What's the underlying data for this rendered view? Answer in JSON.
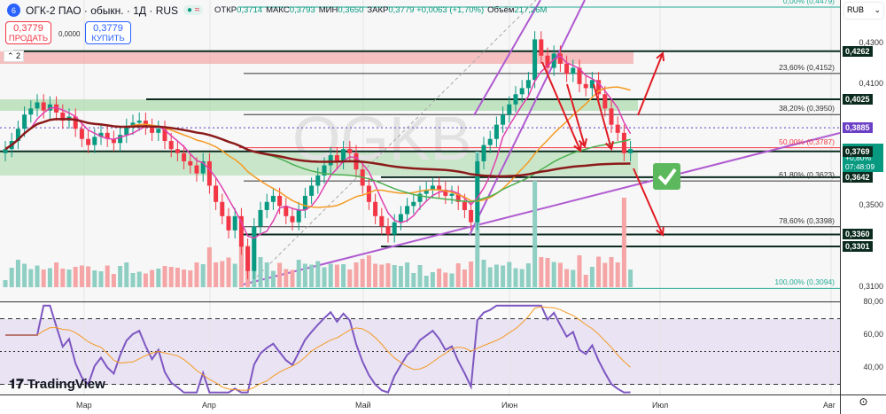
{
  "header": {
    "logo": "6",
    "symbol": "ОГК-2 ПАО · обыкн. · 1Д · RUS",
    "market_status": "●",
    "delay_icon": "≈",
    "ohlc": [
      {
        "k": "ОТКР",
        "v": "0,3714"
      },
      {
        "k": "МАКС",
        "v": "0,3793"
      },
      {
        "k": "МИН",
        "v": "0,3650"
      },
      {
        "k": "ЗАКР",
        "v": "0,3779 +0,0063 (+1,70%)"
      },
      {
        "k": "Объём",
        "v": "217,26M"
      }
    ]
  },
  "trade": {
    "sell_price": "0,3779",
    "sell_label": "ПРОДАТЬ",
    "spread": "0,0000",
    "buy_price": "0,3779",
    "buy_label": "КУПИТЬ"
  },
  "indicator_count": "2",
  "currency": "RUB",
  "price_axis": [
    "0,4300",
    "0,4100",
    "0,3500",
    "0,3100"
  ],
  "price_tags": [
    {
      "v": "0,4262",
      "p": 0.4262
    },
    {
      "v": "0,4025",
      "p": 0.4025
    },
    {
      "v": "0,3769",
      "p": 0.3769
    },
    {
      "v": "0,3642",
      "p": 0.3642
    },
    {
      "v": "0,3360",
      "p": 0.336
    },
    {
      "v": "0,3301",
      "p": 0.3301
    }
  ],
  "ma_tag": {
    "v": "0,3885",
    "p": 0.3885
  },
  "current": {
    "price": "0,3779",
    "change": "+0,80%",
    "countdown": "07:48:09"
  },
  "fib": [
    {
      "label": "0,00% (0,4479)",
      "p": 0.4479,
      "color": "#22ab94"
    },
    {
      "label": "23,60% (0,4152)",
      "p": 0.4152,
      "color": "#333"
    },
    {
      "label": "38,20% (0,3950)",
      "p": 0.395,
      "color": "#333"
    },
    {
      "label": "50,00% (0,3787)",
      "p": 0.3787,
      "color": "#f23645"
    },
    {
      "label": "61,80% (0,3623)",
      "p": 0.3623,
      "color": "#333"
    },
    {
      "label": "78,60% (0,3398)",
      "p": 0.3398,
      "color": "#333"
    },
    {
      "label": "100,00% (0,3094)",
      "p": 0.3094,
      "color": "#22ab94"
    }
  ],
  "rsi_axis": [
    "80,00",
    "60,00",
    "40,00"
  ],
  "time_axis": [
    {
      "l": "Мар",
      "x": 95
    },
    {
      "l": "Апр",
      "x": 237
    },
    {
      "l": "Май",
      "x": 410
    },
    {
      "l": "Июн",
      "x": 575
    },
    {
      "l": "Июл",
      "x": 745
    },
    {
      "l": "Авг",
      "x": 938
    }
  ],
  "brand": "TradingView",
  "watermark": "OGKB",
  "colors": {
    "up": "#089981",
    "down": "#f23645",
    "ma": "#8b1a1a",
    "rsi": "#7e57c2"
  },
  "chart_data": {
    "type": "candlestick",
    "closes": [
      0.378,
      0.382,
      0.388,
      0.395,
      0.398,
      0.401,
      0.397,
      0.4,
      0.396,
      0.392,
      0.394,
      0.388,
      0.383,
      0.38,
      0.384,
      0.386,
      0.383,
      0.381,
      0.385,
      0.389,
      0.391,
      0.392,
      0.389,
      0.386,
      0.388,
      0.382,
      0.378,
      0.376,
      0.372,
      0.37,
      0.366,
      0.372,
      0.36,
      0.352,
      0.345,
      0.338,
      0.345,
      0.33,
      0.318,
      0.34,
      0.348,
      0.352,
      0.355,
      0.35,
      0.345,
      0.342,
      0.348,
      0.355,
      0.36,
      0.365,
      0.37,
      0.375,
      0.372,
      0.378,
      0.376,
      0.368,
      0.36,
      0.352,
      0.345,
      0.34,
      0.336,
      0.342,
      0.346,
      0.35,
      0.352,
      0.356,
      0.358,
      0.36,
      0.358,
      0.355,
      0.356,
      0.352,
      0.348,
      0.342,
      0.372,
      0.38,
      0.383,
      0.39,
      0.395,
      0.4,
      0.405,
      0.408,
      0.412,
      0.432,
      0.424,
      0.418,
      0.425,
      0.42,
      0.415,
      0.418,
      0.41,
      0.408,
      0.412,
      0.405,
      0.398,
      0.39,
      0.386,
      0.376,
      0.378
    ],
    "ylim": [
      0.305,
      0.45
    ],
    "rsi_ylim": [
      20,
      80
    ]
  }
}
